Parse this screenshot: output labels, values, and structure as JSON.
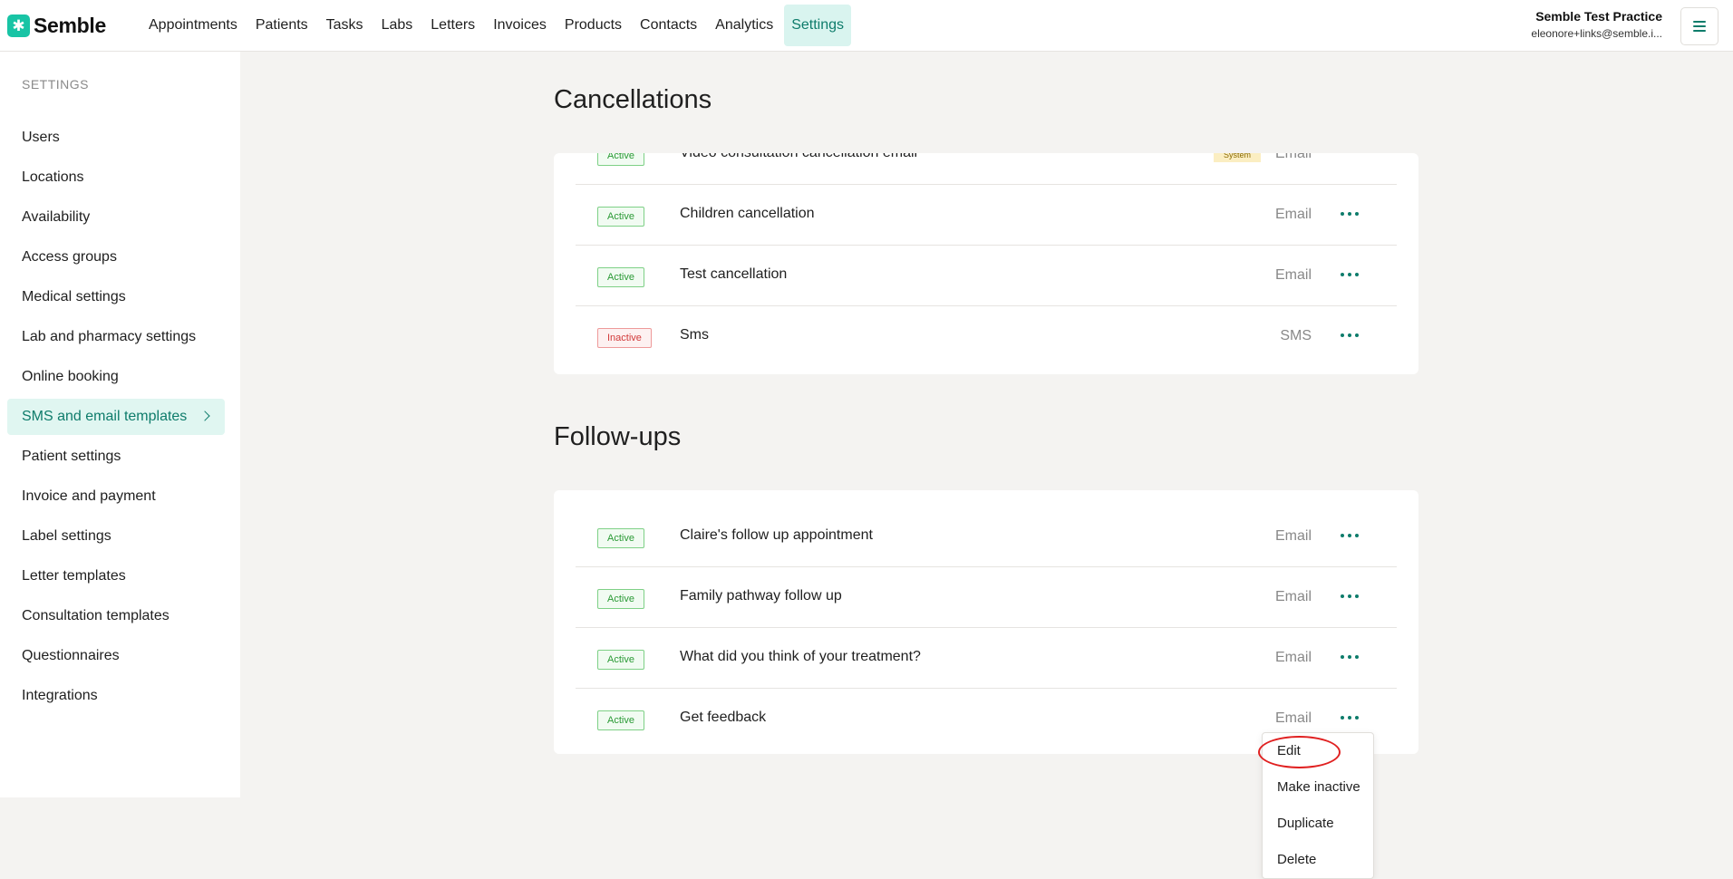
{
  "brand": {
    "name": "Semble"
  },
  "nav": {
    "items": [
      {
        "label": "Appointments",
        "active": false
      },
      {
        "label": "Patients",
        "active": false
      },
      {
        "label": "Tasks",
        "active": false
      },
      {
        "label": "Labs",
        "active": false
      },
      {
        "label": "Letters",
        "active": false
      },
      {
        "label": "Invoices",
        "active": false
      },
      {
        "label": "Products",
        "active": false
      },
      {
        "label": "Contacts",
        "active": false
      },
      {
        "label": "Analytics",
        "active": false
      },
      {
        "label": "Settings",
        "active": true
      }
    ]
  },
  "account": {
    "practice": "Semble Test Practice",
    "email": "eleonore+links@semble.i..."
  },
  "sidebar": {
    "heading": "SETTINGS",
    "items": [
      {
        "label": "Users"
      },
      {
        "label": "Locations"
      },
      {
        "label": "Availability"
      },
      {
        "label": "Access groups"
      },
      {
        "label": "Medical settings"
      },
      {
        "label": "Lab and pharmacy settings"
      },
      {
        "label": "Online booking"
      },
      {
        "label": "SMS and email templates",
        "active": true
      },
      {
        "label": "Patient settings"
      },
      {
        "label": "Invoice and payment"
      },
      {
        "label": "Label settings"
      },
      {
        "label": "Letter templates"
      },
      {
        "label": "Consultation templates"
      },
      {
        "label": "Questionnaires"
      },
      {
        "label": "Integrations"
      }
    ]
  },
  "cancellations": {
    "title": "Cancellations",
    "rows": [
      {
        "status": "Active",
        "name": "Video consultation cancellation email",
        "type": "Email",
        "tag": "System"
      },
      {
        "status": "Active",
        "name": "Children cancellation",
        "type": "Email"
      },
      {
        "status": "Active",
        "name": "Test cancellation",
        "type": "Email"
      },
      {
        "status": "Inactive",
        "name": "Sms",
        "type": "SMS"
      }
    ]
  },
  "followups": {
    "title": "Follow-ups",
    "rows": [
      {
        "status": "Active",
        "name": "Claire's follow up appointment",
        "type": "Email"
      },
      {
        "status": "Active",
        "name": "Family pathway follow up",
        "type": "Email"
      },
      {
        "status": "Active",
        "name": "What did you think of your treatment?",
        "type": "Email"
      },
      {
        "status": "Active",
        "name": "Get feedback",
        "type": "Email"
      }
    ]
  },
  "row_menu": {
    "items": [
      {
        "label": "Edit"
      },
      {
        "label": "Make inactive"
      },
      {
        "label": "Duplicate"
      },
      {
        "label": "Delete"
      }
    ]
  },
  "colors": {
    "accent": "#0e7c6b",
    "logo": "#18c4a5",
    "active_badge": "#2a9a35",
    "inactive_badge": "#d23a3a",
    "highlight": "#e02020"
  }
}
